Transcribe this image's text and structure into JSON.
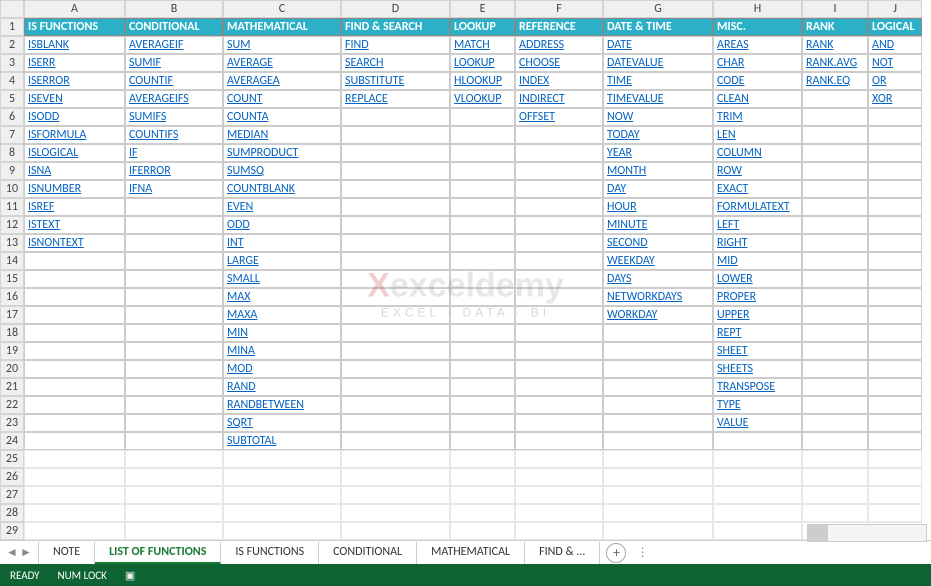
{
  "columns": [
    "",
    "A",
    "B",
    "C",
    "D",
    "E",
    "F",
    "G",
    "H",
    "I",
    "J"
  ],
  "rowCount": 29,
  "headerRow": [
    "IS FUNCTIONS",
    "CONDITIONAL",
    "MATHEMATICAL",
    "FIND & SEARCH",
    "LOOKUP",
    "REFERENCE",
    "DATE & TIME",
    "MISC.",
    "RANK",
    "LOGICAL"
  ],
  "cols": {
    "A": [
      "ISBLANK",
      "ISERR",
      "ISERROR",
      "ISEVEN",
      "ISODD",
      "ISFORMULA",
      "ISLOGICAL",
      "ISNA",
      "ISNUMBER",
      "ISREF",
      "ISTEXT",
      "ISNONTEXT"
    ],
    "B": [
      "AVERAGEIF",
      "SUMIF",
      "COUNTIF",
      "AVERAGEIFS",
      "SUMIFS",
      "COUNTIFS",
      "IF",
      "IFERROR",
      "IFNA"
    ],
    "C": [
      "SUM",
      "AVERAGE",
      "AVERAGEA",
      "COUNT",
      "COUNTA",
      "MEDIAN",
      "SUMPRODUCT",
      "SUMSQ",
      "COUNTBLANK",
      "EVEN",
      "ODD",
      "INT",
      "LARGE",
      "SMALL",
      "MAX",
      "MAXA",
      "MIN",
      "MINA",
      "MOD",
      "RAND",
      "RANDBETWEEN",
      "SQRT",
      "SUBTOTAL"
    ],
    "D": [
      "FIND",
      "SEARCH",
      "SUBSTITUTE",
      "REPLACE"
    ],
    "E": [
      "MATCH",
      "LOOKUP",
      "HLOOKUP",
      "VLOOKUP"
    ],
    "F": [
      "ADDRESS",
      "CHOOSE",
      "INDEX",
      "INDIRECT",
      "OFFSET"
    ],
    "G": [
      "DATE",
      "DATEVALUE",
      "TIME",
      "TIMEVALUE",
      "NOW",
      "TODAY",
      "YEAR",
      "MONTH",
      "DAY",
      "HOUR",
      "MINUTE",
      "SECOND",
      "WEEKDAY",
      "DAYS",
      "NETWORKDAYS",
      "WORKDAY"
    ],
    "H": [
      "AREAS",
      "CHAR",
      "CODE",
      "CLEAN",
      "TRIM",
      "LEN",
      "COLUMN",
      "ROW",
      "EXACT",
      "FORMULATEXT",
      "LEFT",
      "RIGHT",
      "MID",
      "LOWER",
      "PROPER",
      "UPPER",
      "REPT",
      "SHEET",
      "SHEETS",
      "TRANSPOSE",
      "TYPE",
      "VALUE"
    ],
    "I": [
      "RANK",
      "RANK.AVG",
      "RANK.EQ"
    ],
    "J": [
      "AND",
      "NOT",
      "OR",
      "XOR"
    ]
  },
  "tabs": [
    {
      "label": "NOTE",
      "active": false
    },
    {
      "label": "LIST OF FUNCTIONS",
      "active": true
    },
    {
      "label": "IS FUNCTIONS",
      "active": false
    },
    {
      "label": "CONDITIONAL",
      "active": false
    },
    {
      "label": "MATHEMATICAL",
      "active": false
    },
    {
      "label": "FIND & ...",
      "active": false
    }
  ],
  "status": {
    "ready": "READY",
    "numlock": "NUM LOCK"
  },
  "watermark": {
    "brand": "exceldemy",
    "x": "X",
    "sub": "EXCEL · DATA · BI"
  }
}
